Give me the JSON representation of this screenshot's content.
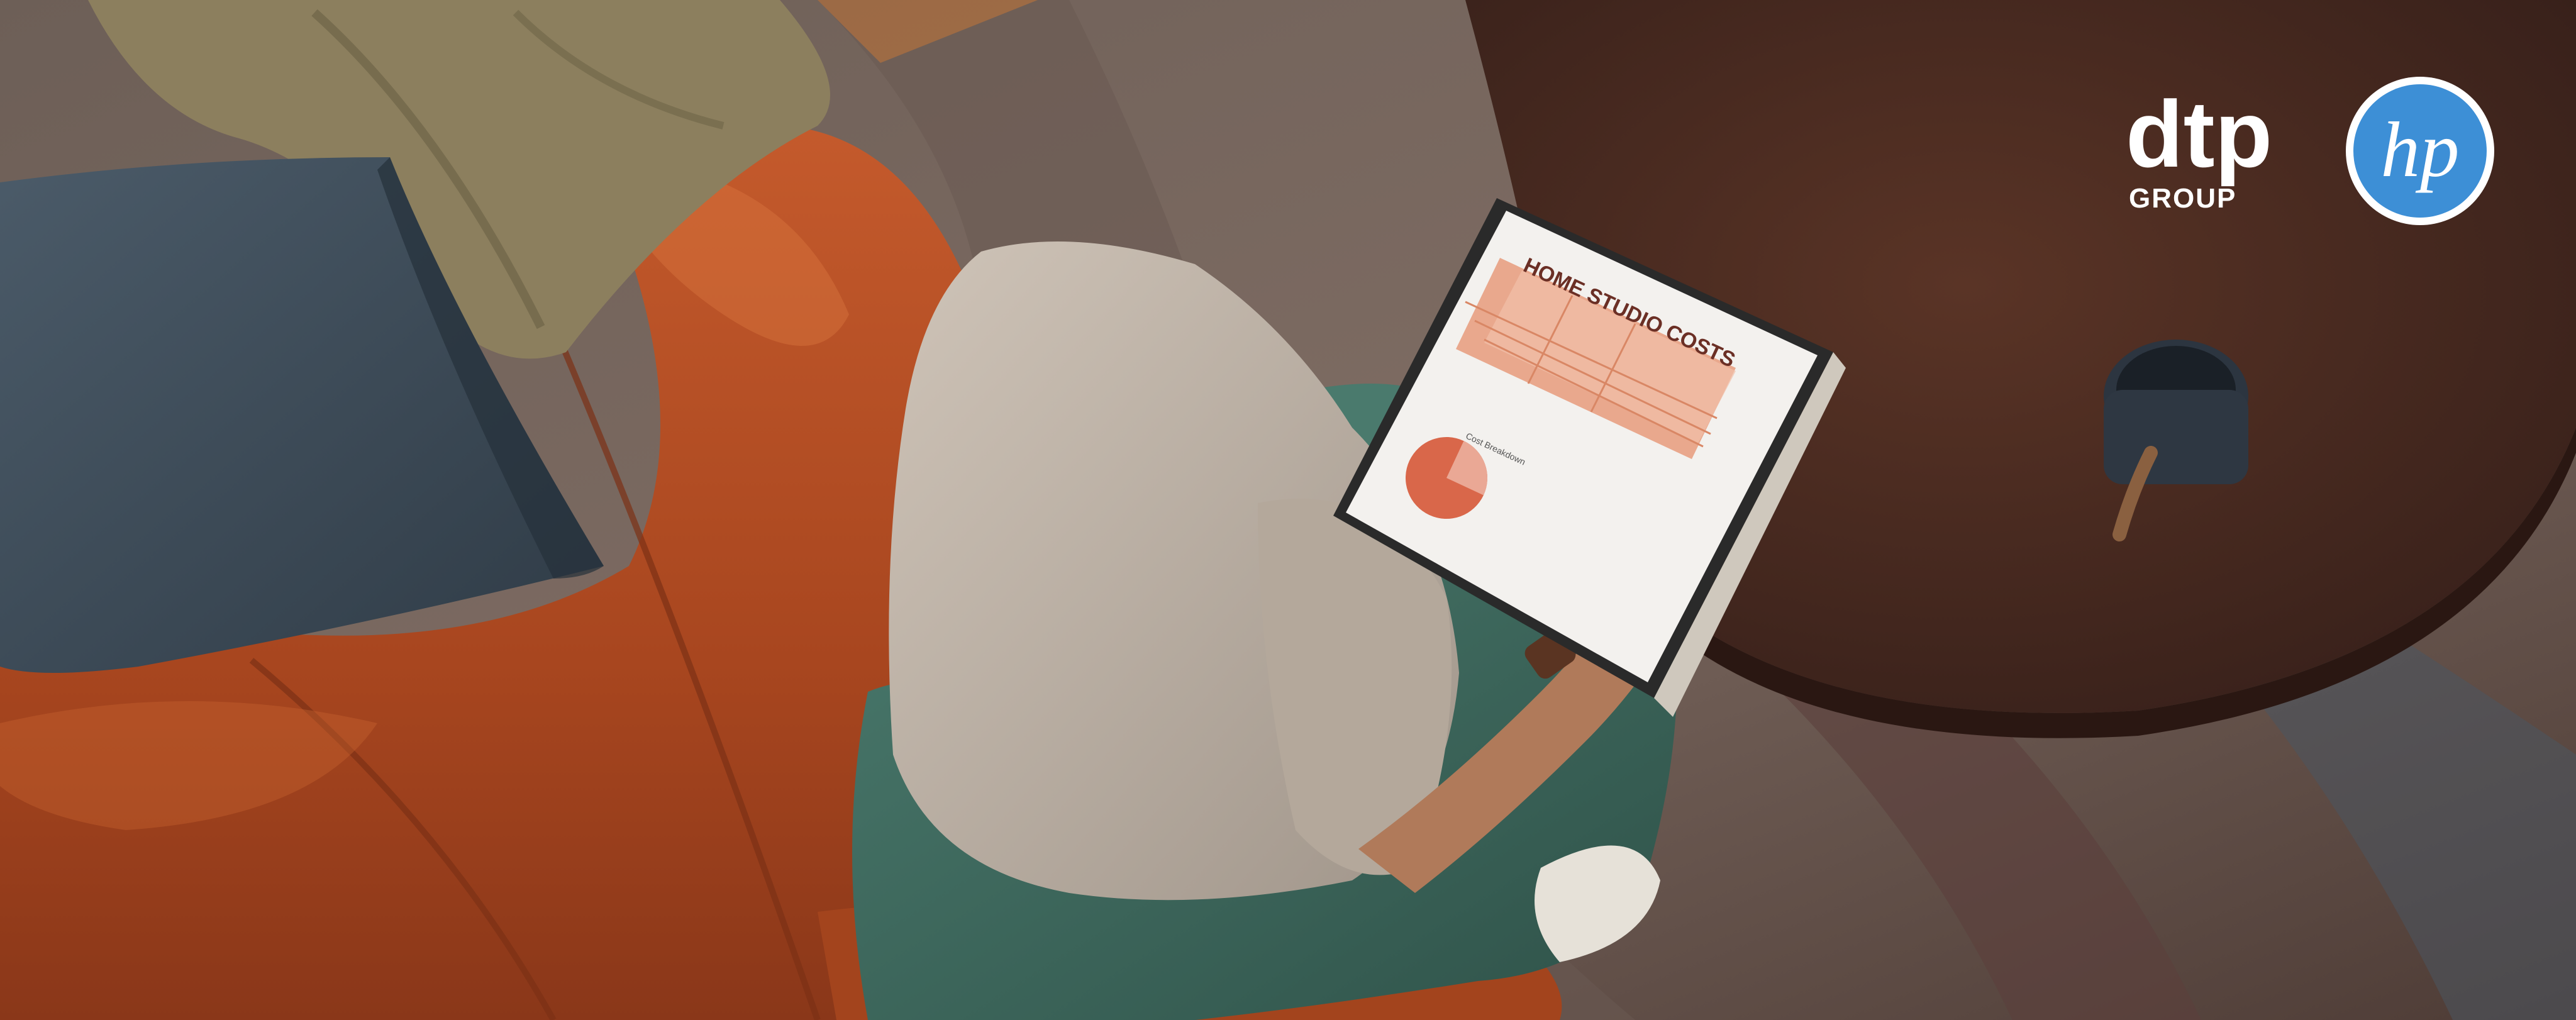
{
  "screen": {
    "title": "HOME STUDIO COSTS",
    "chart_title": "Cost Breakdown",
    "pie_share_light": 0.25
  },
  "logos": {
    "dtp": {
      "wordmark": "dtp",
      "subline": "GROUP"
    },
    "hp": {
      "wordmark": "hp",
      "color": "#3d8fd6"
    }
  },
  "colors": {
    "sofa": "#b04d26",
    "sofa_highlight": "#cf6b3c",
    "floor_rug": "#8a7a70",
    "table": "#4a2a1f",
    "pillow": "#3e4c59",
    "throw": "#8c7f5e",
    "shirt": "#b9ada0",
    "pants": "#3f6a5f",
    "hair": "#3b2319",
    "sheet_accent": "#d98765",
    "pie_main": "#d9674a",
    "pie_light": "#eaa895"
  }
}
